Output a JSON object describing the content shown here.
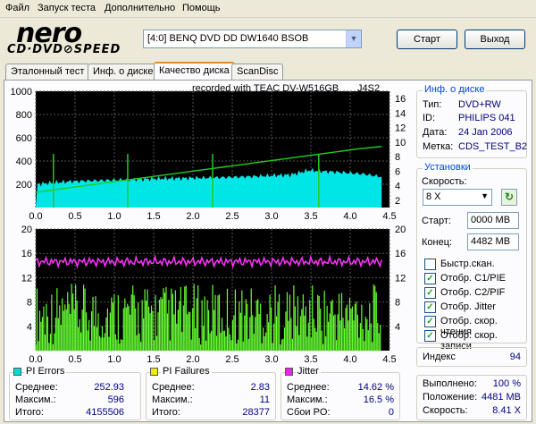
{
  "menu": [
    "Файл",
    "Запуск теста",
    "Дополнительно",
    "Помощь"
  ],
  "logo": {
    "top": "nero",
    "bottom": "CD·DVD⊘SPEED"
  },
  "drive": {
    "value": "[4:0]  BENQ DVD DD DW1640 BSOB"
  },
  "buttons": {
    "start": "Старт",
    "exit": "Выход"
  },
  "tabs": [
    "Эталонный тест",
    "Инф. о диске",
    "Качество диска",
    "ScanDisc"
  ],
  "chart_header": {
    "recorded": "recorded with TEAC   DV-W516GB",
    "firmware": "J4S2"
  },
  "chart_data": [
    {
      "type": "area",
      "x_ticks": [
        "0.0",
        "0.5",
        "1.0",
        "1.5",
        "2.0",
        "2.5",
        "3.0",
        "3.5",
        "4.0",
        "4.5"
      ],
      "y_left_ticks": [
        "1000",
        "800",
        "600",
        "400",
        "200"
      ],
      "y_right_ticks": [
        "16",
        "14",
        "12",
        "10",
        "8",
        "6",
        "4",
        "2"
      ],
      "ylim_left": [
        0,
        1000
      ],
      "ylim_right": [
        0,
        16
      ],
      "series": [
        {
          "name": "PI Errors",
          "color": "#00e5e5",
          "values": [
            200,
            215,
            225,
            230,
            235,
            240,
            245,
            250,
            252,
            255,
            258,
            262,
            268,
            275,
            282,
            320,
            310,
            300,
            288,
            265
          ]
        },
        {
          "name": "Speed",
          "color": "#22cc22",
          "values": [
            2.1,
            2.5,
            2.9,
            3.3,
            3.7,
            4.1,
            4.5,
            4.9,
            5.3,
            5.7,
            6.1,
            6.5,
            6.9,
            7.3,
            7.7,
            8.1,
            8.4
          ]
        }
      ]
    },
    {
      "type": "area",
      "x_ticks": [
        "0.0",
        "0.5",
        "1.0",
        "1.5",
        "2.0",
        "2.5",
        "3.0",
        "3.5",
        "4.0",
        "4.5"
      ],
      "y_left_ticks": [
        "20",
        "16",
        "12",
        "8",
        "4"
      ],
      "y_right_ticks": [
        "20",
        "16",
        "12",
        "8",
        "4"
      ],
      "ylim_left": [
        0,
        20
      ],
      "series": [
        {
          "name": "PI Failures",
          "color": "#66ff33",
          "max": 11
        },
        {
          "name": "Jitter",
          "color": "#ff33ff",
          "value": 14.62
        }
      ]
    }
  ],
  "stats": {
    "pi_errors": {
      "title": "PI Errors",
      "color": "#00dddd",
      "avg_label": "Среднее:",
      "avg": "252.93",
      "max_label": "Максим.:",
      "max": "596",
      "total_label": "Итого:",
      "total": "4155506"
    },
    "pi_failures": {
      "title": "PI Failures",
      "color": "#eeee00",
      "avg_label": "Среднее:",
      "avg": "2.83",
      "max_label": "Максим.:",
      "max": "11",
      "total_label": "Итого:",
      "total": "28377"
    },
    "jitter": {
      "title": "Jitter",
      "color": "#ee22ee",
      "avg_label": "Среднее:",
      "avg": "14.62 %",
      "max_label": "Максим.:",
      "max": "16.5 %",
      "po_label": "Сбои PO:",
      "po": "0"
    }
  },
  "disc_info": {
    "title": "Инф. о диске",
    "type_label": "Тип:",
    "type": "DVD+RW",
    "id_label": "ID:",
    "id": "PHILIPS 041",
    "date_label": "Дата:",
    "date": "24 Jan 2006",
    "mark_label": "Метка:",
    "mark": "CDS_TEST_B2"
  },
  "settings": {
    "title": "Установки",
    "speed_label": "Скорость:",
    "speed": "8 X",
    "start_label": "Старт:",
    "start": "0000 MB",
    "end_label": "Конец:",
    "end": "4482 MB",
    "checks": [
      {
        "label": "Быстр.скан.",
        "checked": false
      },
      {
        "label": "Отобр. C1/PIE",
        "checked": true
      },
      {
        "label": "Отобр. C2/PIF",
        "checked": true
      },
      {
        "label": "Отобр. Jitter",
        "checked": true
      },
      {
        "label": "Отобр. скор. чтения",
        "checked": true
      },
      {
        "label": "Отобр. скор. записи",
        "checked": true
      }
    ]
  },
  "index": {
    "label": "Индекс",
    "value": "94"
  },
  "progress": {
    "done_label": "Выполнено:",
    "done": "100 %",
    "pos_label": "Положение:",
    "pos": "4481 MB",
    "speed_label": "Скорость:",
    "speed": "8.41 X"
  }
}
